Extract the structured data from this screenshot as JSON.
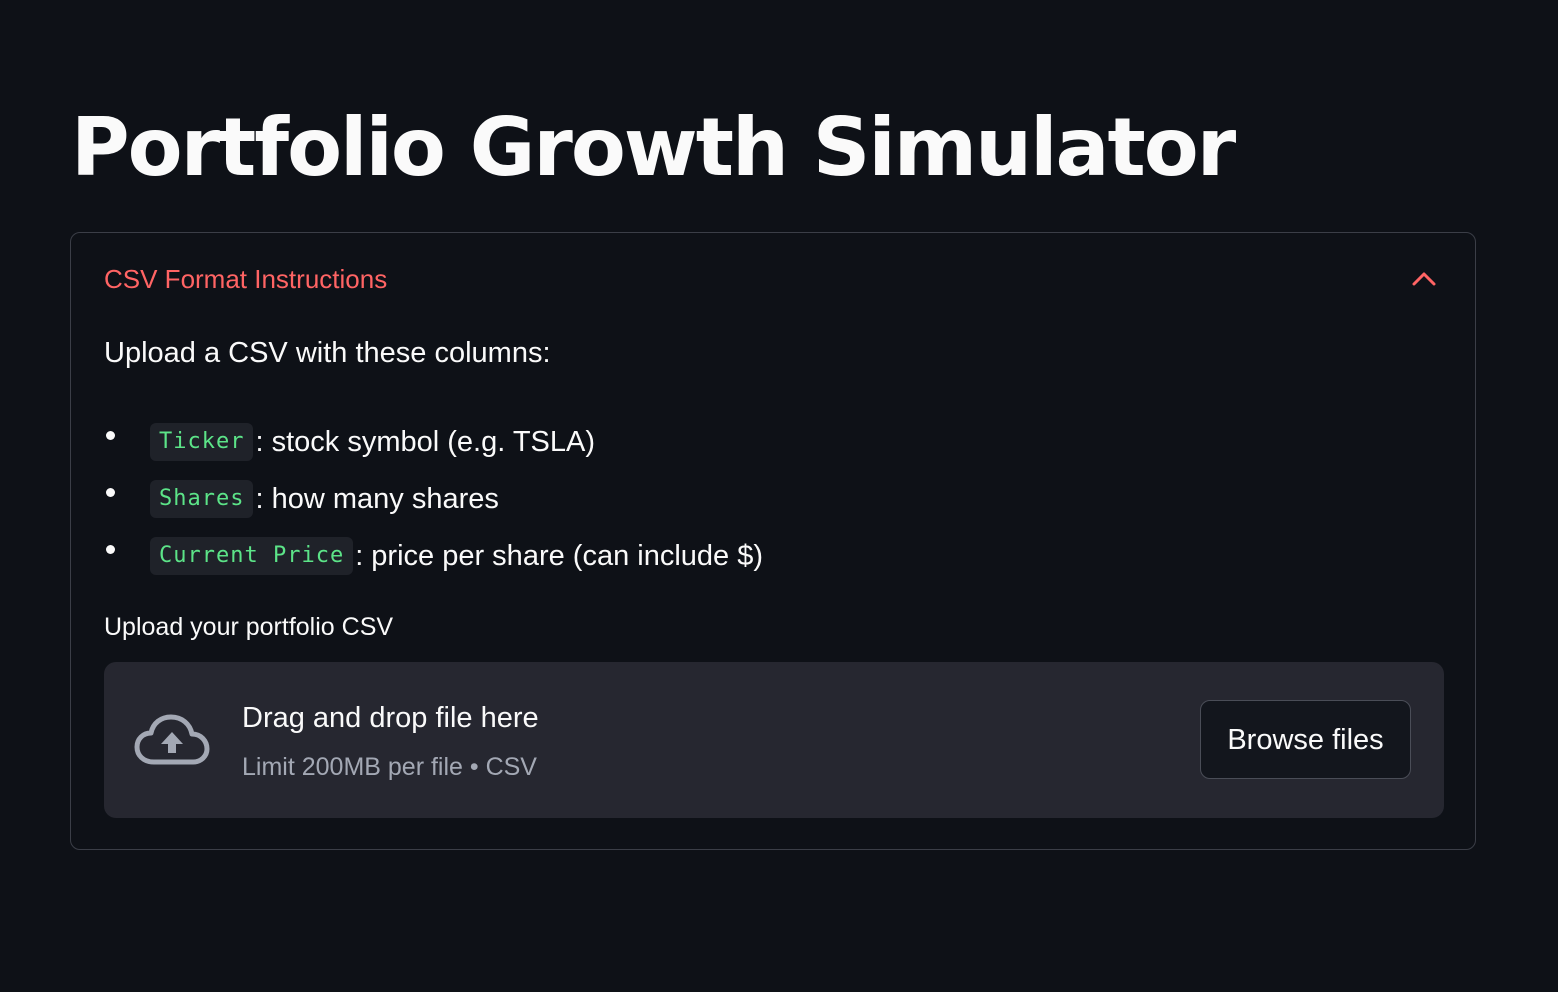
{
  "page": {
    "title": "Portfolio Growth Simulator"
  },
  "expander": {
    "title": "CSV Format Instructions",
    "toggle_icon": "chevron-up-icon",
    "intro": "Upload a CSV with these columns:",
    "columns": [
      {
        "code": "Ticker",
        "description": ": stock symbol (e.g. TSLA)"
      },
      {
        "code": "Shares",
        "description": ": how many shares"
      },
      {
        "code": "Current Price",
        "description": ": price per share (can include $)"
      }
    ]
  },
  "uploader": {
    "label": "Upload your portfolio CSV",
    "icon": "cloud-upload-icon",
    "drag_text": "Drag and drop file here",
    "limit_text": "Limit 200MB per file • CSV",
    "browse_label": "Browse files"
  },
  "colors": {
    "background": "#0e1117",
    "accent": "#ff6464",
    "code_text": "#5ce488",
    "dropzone": "#262730"
  }
}
